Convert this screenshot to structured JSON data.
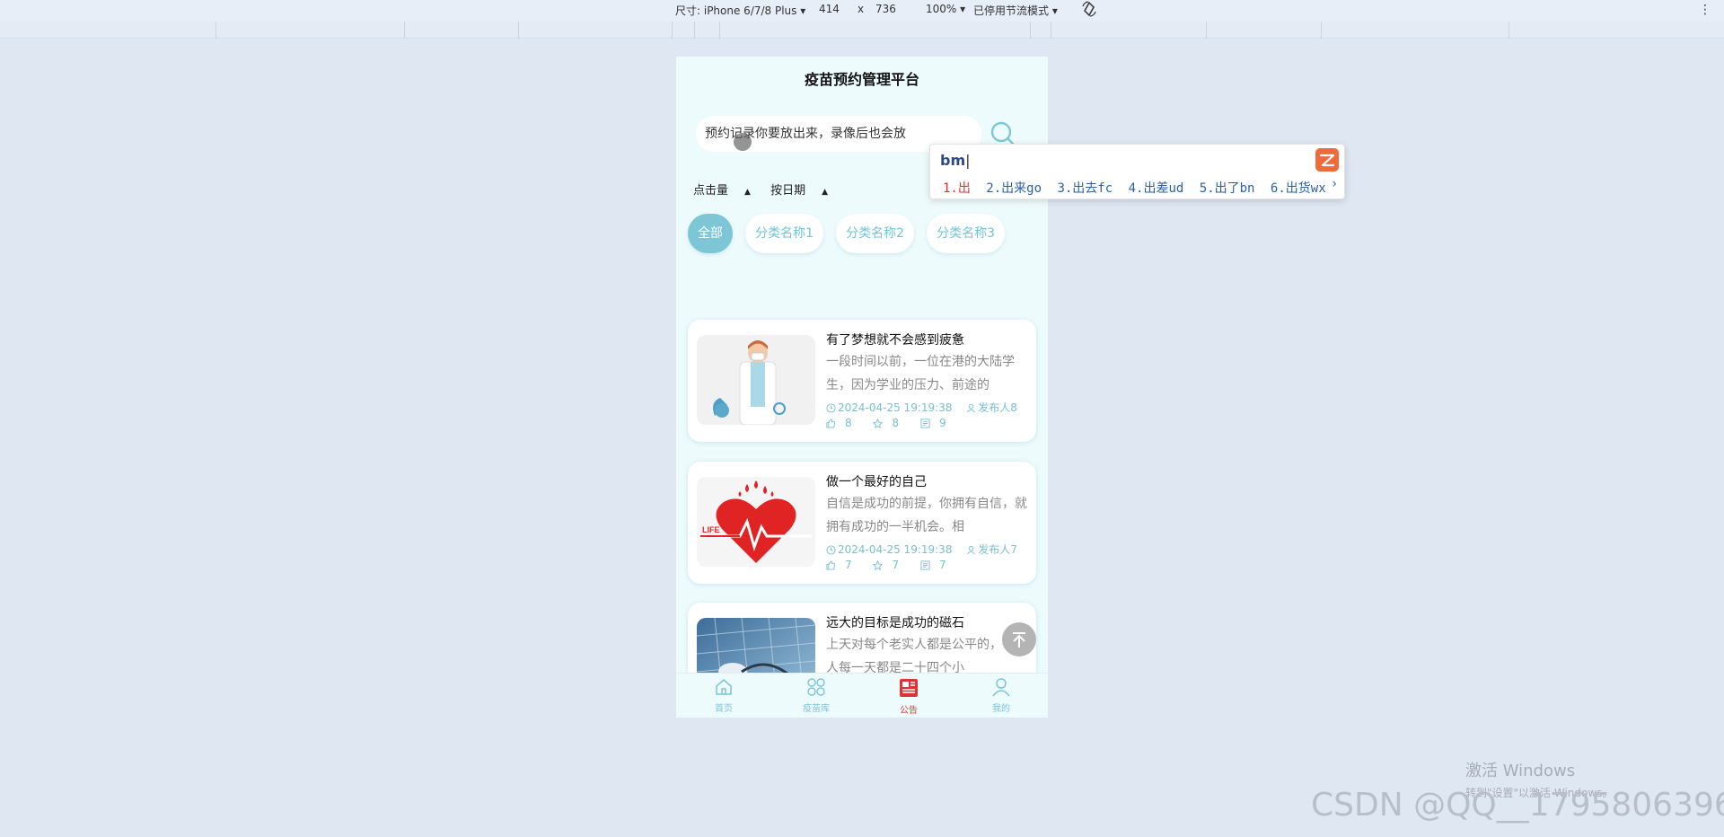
{
  "devtools": {
    "device_label": "尺寸: iPhone 6/7/8 Plus",
    "width": "414",
    "times": "x",
    "height": "736",
    "zoom": "100%",
    "throttle": "已停用节流模式",
    "rotate_icon": "rotate-icon"
  },
  "app": {
    "title": "疫苗预约管理平台",
    "search": {
      "value": "预约记录你要放出来，录像后也会放",
      "icon": "search-icon"
    },
    "sort": [
      "点击量",
      "按日期"
    ],
    "categories": [
      {
        "label": "全部",
        "active": true
      },
      {
        "label": "分类名称1",
        "active": false
      },
      {
        "label": "分类名称2",
        "active": false
      },
      {
        "label": "分类名称3",
        "active": false
      }
    ],
    "posts": [
      {
        "title": "有了梦想就不会感到疲惫",
        "summary": "一段时间以前，一位在港的大陆学生，因为学业的压力、前途的",
        "date": "2024-04-25 19:19:38",
        "publisher": "发布人8",
        "likes": "8",
        "favorites": "8",
        "comments": "9",
        "thumb": "doctor-image"
      },
      {
        "title": "做一个最好的自己",
        "summary": "自信是成功的前提，你拥有自信，就拥有成功的一半机会。相",
        "date": "2024-04-25 19:19:38",
        "publisher": "发布人7",
        "likes": "7",
        "favorites": "7",
        "comments": "7",
        "thumb": "heart-life-image",
        "thumb_text": "LIFE"
      },
      {
        "title": "远大的目标是成功的磁石",
        "summary": "上天对每个老实人都是公平的，每个人每一天都是二十四个小",
        "thumb": "stethoscope-keyboard-image"
      }
    ],
    "tabs": [
      {
        "label": "首页",
        "icon": "home-icon",
        "active": false
      },
      {
        "label": "疫苗库",
        "icon": "grid-icon",
        "active": false
      },
      {
        "label": "公告",
        "icon": "news-icon",
        "active": true
      },
      {
        "label": "我的",
        "icon": "user-icon",
        "active": false
      }
    ],
    "colors": {
      "accent": "#7dc6d6",
      "active_tab": "#d33333",
      "background": "#eefbfd"
    }
  },
  "ime": {
    "composition": "bm",
    "candidates": [
      "1.出",
      "2.出来go",
      "3.出去fc",
      "4.出差ud",
      "5.出了bn",
      "6.出货wx"
    ],
    "next": "›"
  },
  "watermarks": {
    "windows_line1": "激活 Windows",
    "windows_line2": "转到\"设置\"以激活 Windows。",
    "csdn": "CSDN @QQ__1795806396"
  }
}
